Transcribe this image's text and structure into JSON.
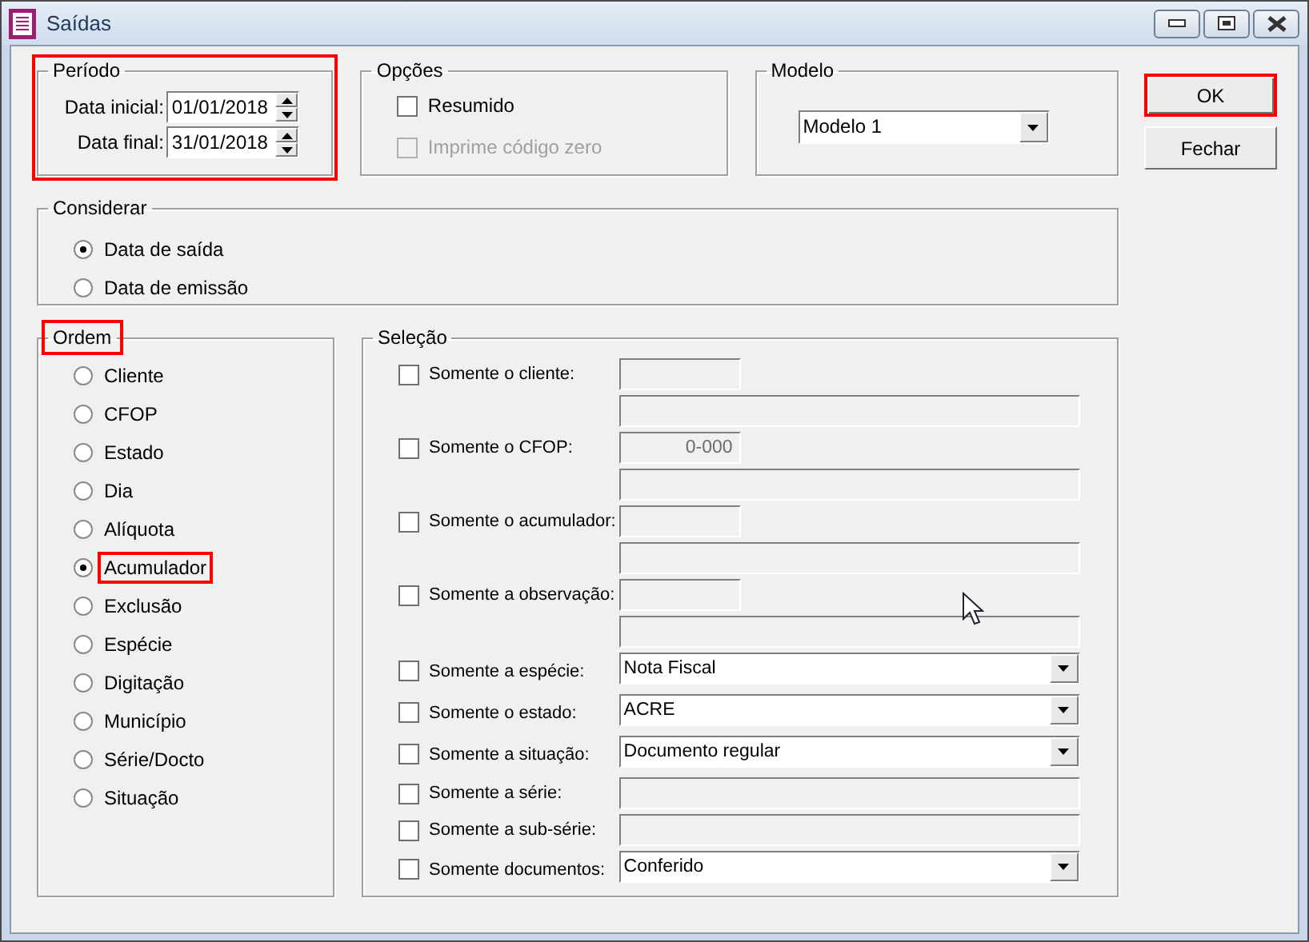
{
  "window": {
    "title": "Saídas"
  },
  "period": {
    "title": "Período",
    "highlighted": true,
    "fields": [
      {
        "label": "Data inicial:",
        "value": "01/01/2018"
      },
      {
        "label": "Data final:",
        "value": "31/01/2018"
      }
    ]
  },
  "options": {
    "title": "Opções",
    "items": [
      {
        "label": "Resumido",
        "checked": false,
        "disabled": false
      },
      {
        "label": "Imprime código zero",
        "checked": false,
        "disabled": true
      }
    ]
  },
  "model": {
    "title": "Modelo",
    "value": "Modelo 1"
  },
  "buttons": [
    {
      "label": "OK",
      "highlighted": true
    },
    {
      "label": "Fechar",
      "highlighted": false
    }
  ],
  "consider": {
    "title": "Considerar",
    "options": [
      {
        "label": "Data de saída",
        "selected": true
      },
      {
        "label": "Data de emissão",
        "selected": false
      }
    ]
  },
  "order": {
    "title": "Ordem",
    "highlighted": true,
    "options": [
      {
        "label": "Cliente",
        "selected": false,
        "highlighted": false
      },
      {
        "label": "CFOP",
        "selected": false,
        "highlighted": false
      },
      {
        "label": "Estado",
        "selected": false,
        "highlighted": false
      },
      {
        "label": "Dia",
        "selected": false,
        "highlighted": false
      },
      {
        "label": "Alíquota",
        "selected": false,
        "highlighted": false
      },
      {
        "label": "Acumulador",
        "selected": true,
        "highlighted": true
      },
      {
        "label": "Exclusão",
        "selected": false,
        "highlighted": false
      },
      {
        "label": "Espécie",
        "selected": false,
        "highlighted": false
      },
      {
        "label": "Digitação",
        "selected": false,
        "highlighted": false
      },
      {
        "label": "Município",
        "selected": false,
        "highlighted": false
      },
      {
        "label": "Série/Docto",
        "selected": false,
        "highlighted": false
      },
      {
        "label": "Situação",
        "selected": false,
        "highlighted": false
      }
    ]
  },
  "selection": {
    "title": "Seleção",
    "items": [
      {
        "label": "Somente o cliente:",
        "checked": false,
        "kind": "pair"
      },
      {
        "label": "Somente o CFOP:",
        "checked": false,
        "kind": "pair",
        "value": "0-000"
      },
      {
        "label": "Somente o acumulador:",
        "checked": false,
        "kind": "pair"
      },
      {
        "label": "Somente a observação:",
        "checked": false,
        "kind": "pair"
      },
      {
        "label": "Somente a espécie:",
        "checked": false,
        "kind": "combo",
        "value": "Nota Fiscal"
      },
      {
        "label": "Somente o estado:",
        "checked": false,
        "kind": "combo",
        "value": "ACRE"
      },
      {
        "label": "Somente a situação:",
        "checked": false,
        "kind": "combo",
        "value": "Documento regular"
      },
      {
        "label": "Somente a série:",
        "checked": false,
        "kind": "text"
      },
      {
        "label": "Somente a sub-série:",
        "checked": false,
        "kind": "text"
      },
      {
        "label": "Somente documentos:",
        "checked": false,
        "kind": "combo",
        "value": "Conferido"
      }
    ]
  }
}
